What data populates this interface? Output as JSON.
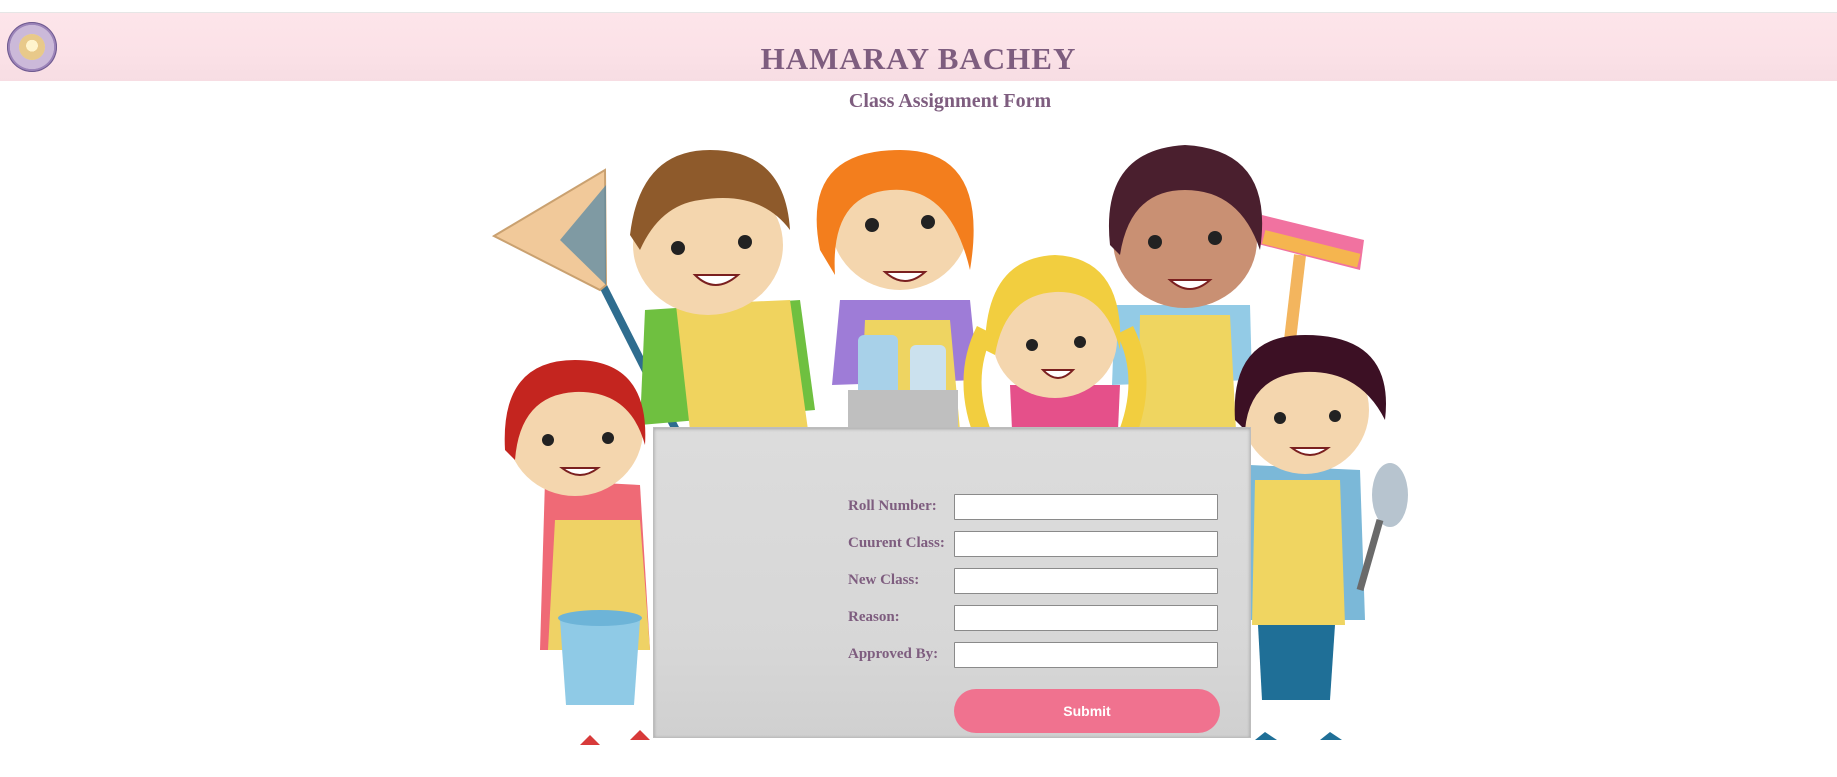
{
  "header": {
    "title": "HAMARAY BACHEY",
    "logo_icon": "school-emblem-icon"
  },
  "page": {
    "subtitle": "Class Assignment Form"
  },
  "form": {
    "fields": [
      {
        "label": "Roll Number:",
        "value": "",
        "placeholder": ""
      },
      {
        "label": "Cuurent Class:",
        "value": "",
        "placeholder": ""
      },
      {
        "label": "New Class:",
        "value": "",
        "placeholder": ""
      },
      {
        "label": "Reason:",
        "value": "",
        "placeholder": ""
      },
      {
        "label": "Approved By:",
        "value": "",
        "placeholder": ""
      }
    ],
    "submit_label": "Submit"
  },
  "colors": {
    "header_bg": "#fbe1e7",
    "title": "#7e5d7f",
    "submit_bg": "#f0728f"
  },
  "illustration": {
    "name": "cleaning-kids-illustration"
  }
}
